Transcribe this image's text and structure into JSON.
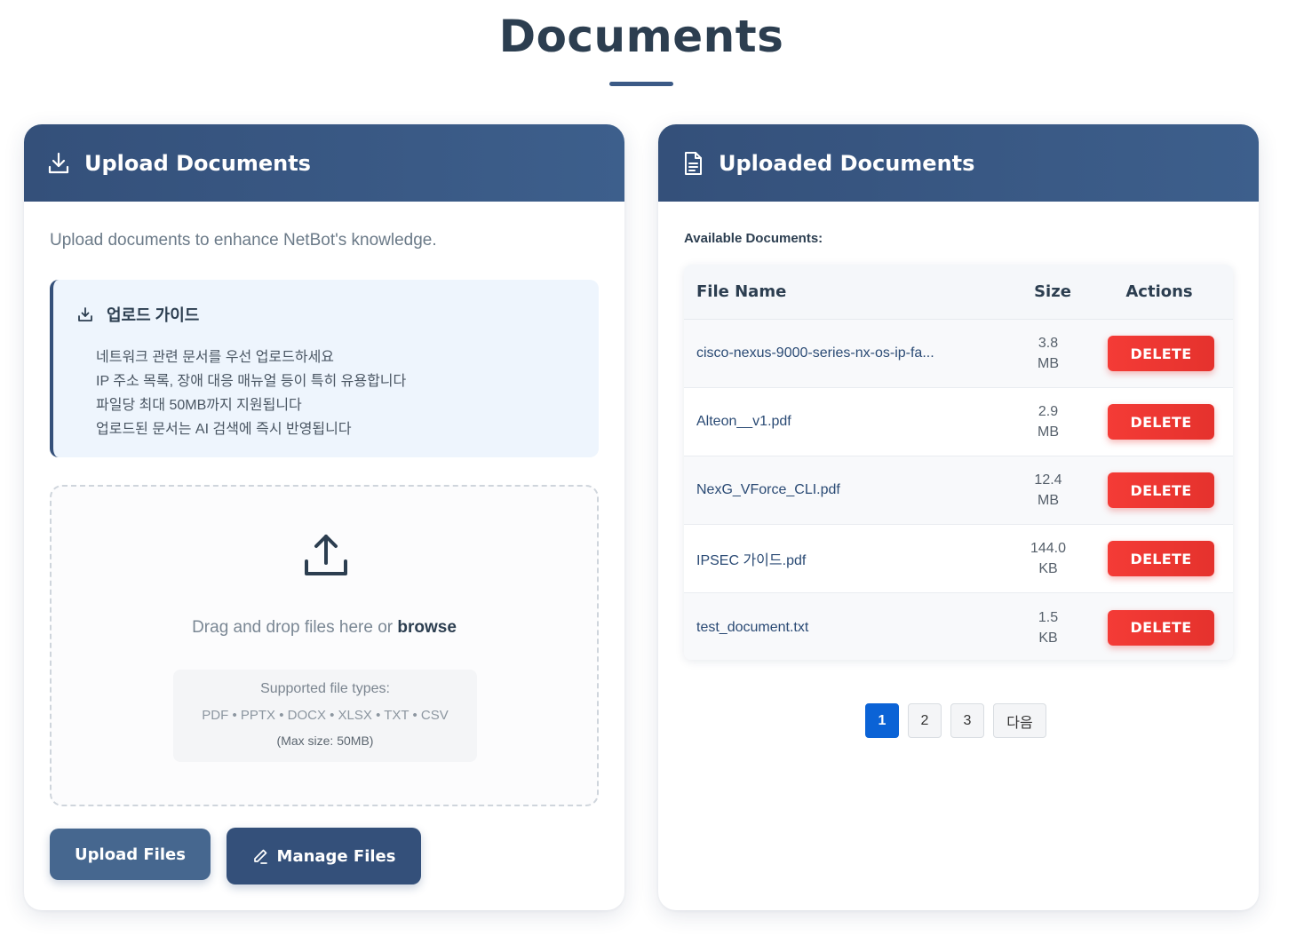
{
  "page": {
    "title": "Documents"
  },
  "upload_card": {
    "title": "Upload Documents",
    "intro": "Upload documents to enhance NetBot's knowledge.",
    "guide": {
      "title": "업로드 가이드",
      "items": [
        "네트워크 관련 문서를 우선 업로드하세요",
        "IP 주소 목록, 장애 대응 매뉴얼 등이 특히 유용합니다",
        "파일당 최대 50MB까지 지원됩니다",
        "업로드된 문서는 AI 검색에 즉시 반영됩니다"
      ]
    },
    "dropzone": {
      "text": "Drag and drop files here or",
      "browse": "browse",
      "types_label": "Supported file types:",
      "types": "PDF • PPTX • DOCX • XLSX • TXT • CSV",
      "max_size": "(Max size: 50MB)"
    },
    "buttons": {
      "upload": "Upload Files",
      "manage": "Manage Files"
    }
  },
  "documents_card": {
    "title": "Uploaded Documents",
    "available_label": "Available Documents:",
    "columns": {
      "name": "File Name",
      "size": "Size",
      "actions": "Actions"
    },
    "rows": [
      {
        "name": "cisco-nexus-9000-series-nx-os-ip-fa...",
        "size_value": "3.8",
        "size_unit": "MB",
        "action": "DELETE"
      },
      {
        "name": "Alteon__v1.pdf",
        "size_value": "2.9",
        "size_unit": "MB",
        "action": "DELETE"
      },
      {
        "name": "NexG_VForce_CLI.pdf",
        "size_value": "12.4",
        "size_unit": "MB",
        "action": "DELETE"
      },
      {
        "name": "IPSEC 가이드.pdf",
        "size_value": "144.0",
        "size_unit": "KB",
        "action": "DELETE"
      },
      {
        "name": "test_document.txt",
        "size_value": "1.5",
        "size_unit": "KB",
        "action": "DELETE"
      }
    ],
    "pagination": {
      "pages": [
        "1",
        "2",
        "3"
      ],
      "current": "1",
      "next": "다음"
    }
  },
  "colors": {
    "header": "#34507a",
    "delete": "#f43b36",
    "active_page": "#0b63d6"
  }
}
